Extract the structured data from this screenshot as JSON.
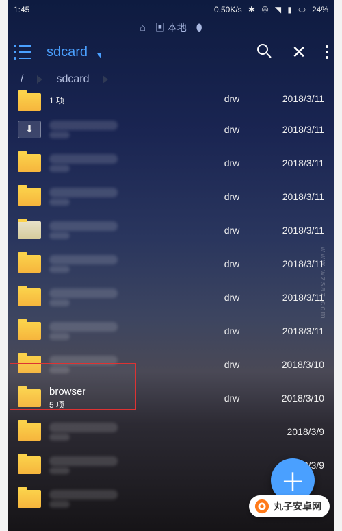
{
  "status": {
    "time": "1:45",
    "net_speed": "0.50K/s",
    "battery": "24%"
  },
  "topicons": {
    "local_label": "本地"
  },
  "toolbar": {
    "title": "sdcard"
  },
  "breadcrumb": {
    "root": "/",
    "current": "sdcard"
  },
  "rows": [
    {
      "icon": "folder",
      "sub_visible": "1 项",
      "perm": "drw",
      "date": "2018/3/11"
    },
    {
      "icon": "download",
      "perm": "drw",
      "date": "2018/3/11"
    },
    {
      "icon": "folder",
      "perm": "drw",
      "date": "2018/3/11"
    },
    {
      "icon": "folder",
      "perm": "drw",
      "date": "2018/3/11"
    },
    {
      "icon": "folder-light",
      "perm": "drw",
      "date": "2018/3/11"
    },
    {
      "icon": "folder",
      "perm": "drw",
      "date": "2018/3/11"
    },
    {
      "icon": "folder",
      "perm": "drw",
      "date": "2018/3/11"
    },
    {
      "icon": "folder",
      "perm": "drw",
      "date": "2018/3/11"
    },
    {
      "icon": "folder",
      "perm": "drw",
      "date": "2018/3/10"
    },
    {
      "icon": "folder",
      "name_visible": "browser",
      "sub_visible": "5 项",
      "perm": "drw",
      "date": "2018/3/10"
    },
    {
      "icon": "folder",
      "perm": "",
      "date": "2018/3/9"
    },
    {
      "icon": "folder",
      "perm": "",
      "date": "2018/3/9"
    },
    {
      "icon": "folder",
      "perm": "",
      "date": ""
    }
  ],
  "highlight_row_index": 9,
  "watermark": {
    "text": "丸子安卓网",
    "url_text": "www.wzsaz.com"
  }
}
